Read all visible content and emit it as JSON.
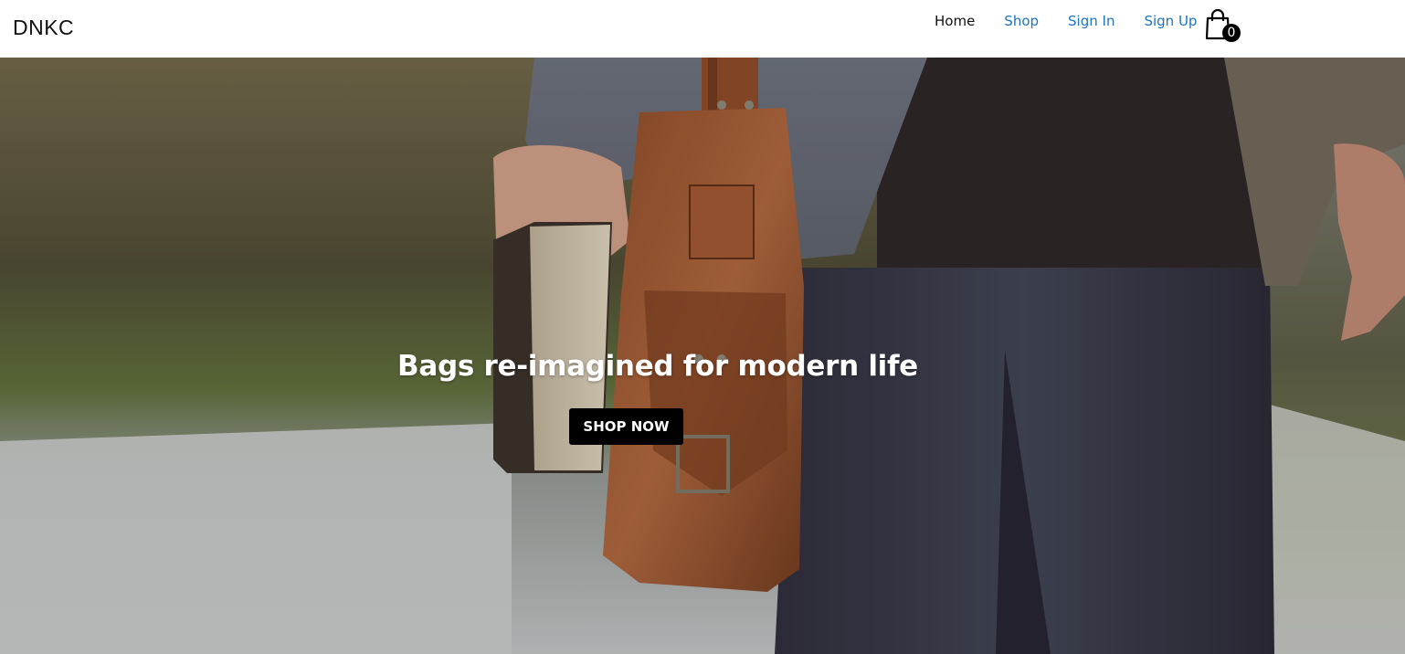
{
  "brand": "DNKC",
  "nav": {
    "links": [
      {
        "label": "Home",
        "active": true
      },
      {
        "label": "Shop",
        "active": false
      },
      {
        "label": "Sign In",
        "active": false
      },
      {
        "label": "Sign Up",
        "active": false
      }
    ],
    "cart_icon": "shopping-bag-icon",
    "cart_count": "0"
  },
  "hero": {
    "title": "Bags re-imagined for modern life",
    "button_label": "SHOP NOW",
    "image_description_icon": "hero-image"
  },
  "colors": {
    "link": "#1e73be",
    "active_link": "#111111",
    "button_bg": "#000000",
    "button_text": "#ffffff"
  }
}
